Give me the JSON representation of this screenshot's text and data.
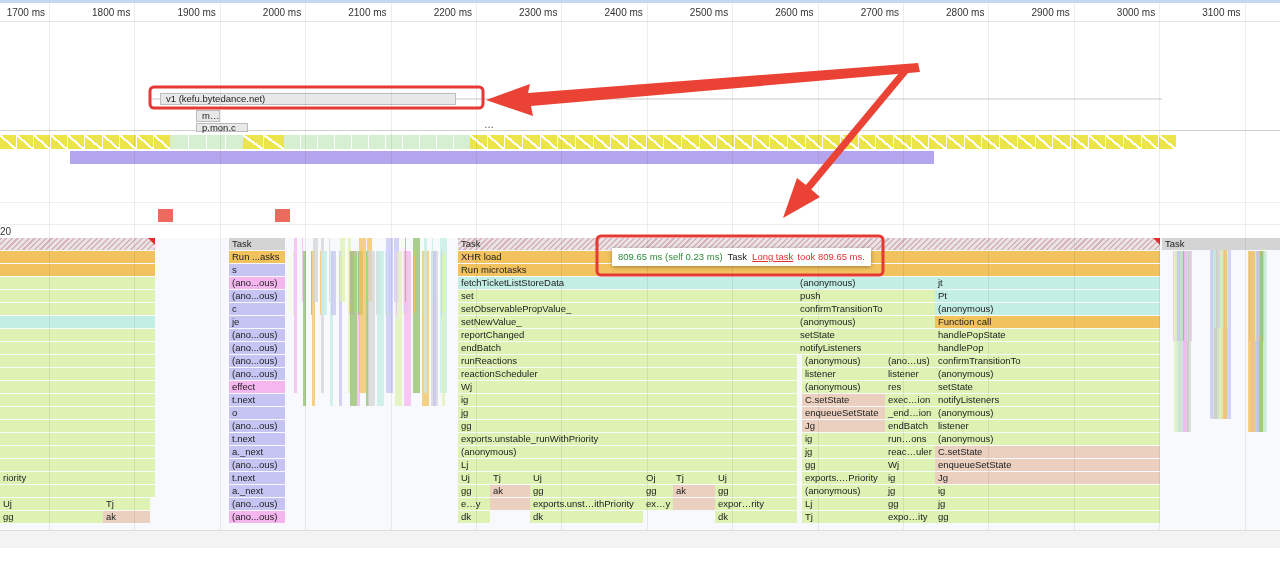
{
  "ruler": {
    "labels": [
      "1700 ms",
      "1800 ms",
      "1900 ms",
      "2000 ms",
      "2100 ms",
      "2200 ms",
      "2300 ms",
      "2400 ms",
      "2500 ms",
      "2600 ms",
      "2700 ms",
      "2800 ms",
      "2900 ms",
      "3000 ms",
      "3100 ms"
    ]
  },
  "network": {
    "requests": [
      {
        "label": "v1 (kefu.bytedance.net)"
      },
      {
        "label": "m…"
      },
      {
        "label": "p.mon.c"
      }
    ],
    "more": "…"
  },
  "frames": [
    {
      "kind": "dropped"
    },
    {
      "kind": "idle"
    },
    {
      "kind": "dropped"
    },
    {
      "kind": "idle"
    },
    {
      "kind": "dropped"
    }
  ],
  "track_label": "20",
  "flame_chart": {
    "columns": [
      {
        "entries": [
          {
            "kind": "long_task"
          },
          {
            "kind": "event"
          },
          {
            "kind": "event"
          },
          {
            "kind": "script"
          },
          {
            "kind": "script"
          },
          {
            "kind": "script"
          },
          {
            "kind": "callback"
          },
          {
            "kind": "script"
          },
          {
            "kind": "script"
          },
          {
            "kind": "script"
          },
          {
            "kind": "script"
          },
          {
            "kind": "script"
          },
          {
            "kind": "script"
          },
          {
            "kind": "script"
          },
          {
            "kind": "script"
          },
          {
            "kind": "script"
          },
          {
            "kind": "script"
          },
          {
            "kind": "script"
          },
          {
            "label": "riority",
            "kind": "script"
          },
          {
            "kind": "script"
          }
        ]
      },
      {
        "entries": [
          {
            "label": "Uj",
            "kind": "script"
          },
          {
            "label": "gg",
            "kind": "script"
          }
        ]
      },
      {
        "entries": [
          {
            "label": "Tj",
            "kind": "script"
          },
          {
            "label": "ak",
            "kind": "react"
          }
        ]
      },
      {
        "entries": [
          {
            "label": "Task",
            "kind": "task"
          },
          {
            "label": "Run ...asks",
            "kind": "event"
          },
          {
            "label": "s",
            "kind": "library"
          },
          {
            "label": "(ano...ous)",
            "kind": "effect"
          },
          {
            "label": "(ano...ous)",
            "kind": "library"
          },
          {
            "label": "c",
            "kind": "library"
          },
          {
            "label": "je",
            "kind": "library"
          },
          {
            "label": "(ano...ous)",
            "kind": "library"
          },
          {
            "label": "(ano...ous)",
            "kind": "library"
          },
          {
            "label": "(ano...ous)",
            "kind": "library"
          },
          {
            "label": "(ano...ous)",
            "kind": "library"
          },
          {
            "label": "effect",
            "kind": "effect"
          },
          {
            "label": "t.next",
            "kind": "library"
          },
          {
            "label": "o",
            "kind": "library"
          },
          {
            "label": "(ano...ous)",
            "kind": "library"
          },
          {
            "label": "t.next",
            "kind": "library"
          },
          {
            "label": "a._next",
            "kind": "library"
          },
          {
            "label": "(ano...ous)",
            "kind": "library"
          },
          {
            "label": "t.next",
            "kind": "library"
          },
          {
            "label": "a._next",
            "kind": "library"
          },
          {
            "label": "(ano...ous)",
            "kind": "library"
          },
          {
            "label": "(ano...ous)",
            "kind": "effect"
          }
        ]
      },
      {
        "entries": [
          {
            "label": "Task",
            "kind": "long_task"
          },
          {
            "label": "XHR load",
            "kind": "event"
          },
          {
            "label": "Run microtasks",
            "kind": "event"
          }
        ]
      },
      {
        "entries": [
          {
            "label": "fetchTicketListStoreData",
            "kind": "callback"
          },
          {
            "label": "set",
            "kind": "script"
          },
          {
            "label": "setObservablePropValue_",
            "kind": "script"
          },
          {
            "label": "setNewValue_",
            "kind": "script"
          },
          {
            "label": "reportChanged",
            "kind": "script"
          },
          {
            "label": "endBatch",
            "kind": "script"
          },
          {
            "label": "runReactions",
            "kind": "script"
          },
          {
            "label": "reactionScheduler",
            "kind": "script"
          },
          {
            "label": "Wj",
            "kind": "script"
          },
          {
            "label": "ig",
            "kind": "script"
          },
          {
            "label": "jg",
            "kind": "script"
          },
          {
            "label": "gg",
            "kind": "script"
          },
          {
            "label": "exports.unstable_runWithPriority",
            "kind": "script"
          },
          {
            "label": "(anonymous)",
            "kind": "script"
          },
          {
            "label": "Lj",
            "kind": "script"
          }
        ]
      },
      {
        "entries": [
          {
            "label": "Uj",
            "kind": "script"
          },
          {
            "label": "gg",
            "kind": "script"
          },
          {
            "label": "e…y",
            "kind": "script"
          },
          {
            "label": "dk",
            "kind": "script"
          }
        ]
      },
      {
        "entries": [
          {
            "label": "Tj",
            "kind": "script"
          },
          {
            "label": "ak",
            "kind": "react"
          },
          {
            "kind": "react"
          }
        ]
      },
      {
        "entries": [
          {
            "label": "Uj",
            "kind": "script"
          },
          {
            "label": "gg",
            "kind": "script"
          },
          {
            "label": "exports.unst…ithPriority",
            "kind": "script"
          },
          {
            "label": "dk",
            "kind": "script"
          }
        ]
      },
      {
        "entries": [
          {
            "label": "Oj",
            "kind": "script"
          },
          {
            "label": "gg",
            "kind": "script"
          },
          {
            "label": "ex…y",
            "kind": "script"
          }
        ]
      },
      {
        "entries": [
          {
            "label": "Tj",
            "kind": "script"
          },
          {
            "label": "ak",
            "kind": "react"
          },
          {
            "kind": "react"
          }
        ]
      },
      {
        "entries": [
          {
            "label": "Uj",
            "kind": "script"
          },
          {
            "label": "gg",
            "kind": "script"
          },
          {
            "label": "expor…rity",
            "kind": "script"
          },
          {
            "label": "dk",
            "kind": "script"
          }
        ]
      },
      {
        "entries": [
          {
            "label": "(anonymous)",
            "kind": "callback"
          },
          {
            "label": "push",
            "kind": "script"
          },
          {
            "label": "confirmTransitionTo",
            "kind": "script"
          },
          {
            "label": "(anonymous)",
            "kind": "script"
          },
          {
            "label": "setState",
            "kind": "script"
          },
          {
            "label": "notifyListeners",
            "kind": "script"
          }
        ]
      },
      {
        "entries": [
          {
            "label": "(anonymous)",
            "kind": "script"
          },
          {
            "label": "listener",
            "kind": "script"
          },
          {
            "label": "(anonymous)",
            "kind": "script"
          },
          {
            "label": "C.setState",
            "kind": "react"
          },
          {
            "label": "enqueueSetState",
            "kind": "react"
          },
          {
            "label": "Jg",
            "kind": "react"
          },
          {
            "label": "ig",
            "kind": "script"
          },
          {
            "label": "jg",
            "kind": "script"
          },
          {
            "label": "gg",
            "kind": "script"
          },
          {
            "label": "exports.…Priority",
            "kind": "script"
          },
          {
            "label": "(anonymous)",
            "kind": "script"
          },
          {
            "label": "Lj",
            "kind": "script"
          },
          {
            "label": "Tj",
            "kind": "script"
          }
        ]
      },
      {
        "entries": [
          {
            "label": "(ano…us)",
            "kind": "script"
          },
          {
            "label": "listener",
            "kind": "script"
          },
          {
            "label": "res",
            "kind": "script"
          },
          {
            "label": "exec…ion",
            "kind": "script"
          },
          {
            "label": "_end…ion",
            "kind": "script"
          },
          {
            "label": "endBatch",
            "kind": "script"
          },
          {
            "label": "run…ons",
            "kind": "script"
          },
          {
            "label": "reac…uler",
            "kind": "script"
          },
          {
            "label": "Wj",
            "kind": "script"
          },
          {
            "label": "ig",
            "kind": "script"
          },
          {
            "label": "jg",
            "kind": "script"
          },
          {
            "label": "gg",
            "kind": "script"
          },
          {
            "label": "expo…ity",
            "kind": "script"
          }
        ]
      },
      {
        "entries": [
          {
            "label": "jt",
            "kind": "callback"
          },
          {
            "label": "Pt",
            "kind": "callback"
          },
          {
            "label": "(anonymous)",
            "kind": "callback"
          },
          {
            "label": "Function call",
            "kind": "event"
          },
          {
            "label": "handlePopState",
            "kind": "script"
          },
          {
            "label": "handlePop",
            "kind": "script"
          },
          {
            "label": "confirmTransitionTo",
            "kind": "script"
          },
          {
            "label": "(anonymous)",
            "kind": "script"
          },
          {
            "label": "setState",
            "kind": "script"
          },
          {
            "label": "notifyListeners",
            "kind": "script"
          },
          {
            "label": "(anonymous)",
            "kind": "script"
          },
          {
            "label": "listener",
            "kind": "script"
          },
          {
            "label": "(anonymous)",
            "kind": "script"
          },
          {
            "label": "C.setState",
            "kind": "react"
          },
          {
            "label": "enqueueSetState",
            "kind": "react"
          },
          {
            "label": "Jg",
            "kind": "react"
          },
          {
            "label": "ig",
            "kind": "script"
          },
          {
            "label": "jg",
            "kind": "script"
          },
          {
            "label": "gg",
            "kind": "script"
          }
        ]
      },
      {
        "entries": [
          {
            "label": "Task",
            "kind": "task"
          }
        ]
      }
    ]
  },
  "tooltip": {
    "duration": "809.65 ms (self 0.23 ms)",
    "title": "Task",
    "warning_link": "Long task",
    "warning_text": "took 809.65 ms."
  }
}
